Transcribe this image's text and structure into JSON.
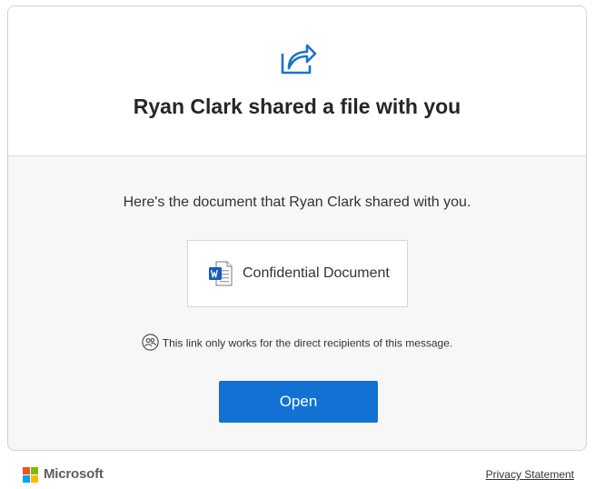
{
  "header": {
    "icon": "share-arrow-icon",
    "title": "Ryan Clark shared a file with you"
  },
  "body": {
    "message": "Here's the document that Ryan Clark shared with you.",
    "document": {
      "icon": "word-document-icon",
      "name": "Confidential Document"
    },
    "notice": {
      "icon": "people-icon",
      "text": "This link only works for the direct recipients of this message."
    },
    "open_button_label": "Open"
  },
  "footer": {
    "brand": "Microsoft",
    "brand_icon": "microsoft-logo-icon",
    "privacy_link": "Privacy Statement"
  },
  "colors": {
    "accent": "#1272d3",
    "share_icon": "#1a73c8",
    "word_blue": "#185abd",
    "ms_red": "#f25022",
    "ms_green": "#7fba00",
    "ms_blue": "#00a4ef",
    "ms_yellow": "#ffb900"
  }
}
